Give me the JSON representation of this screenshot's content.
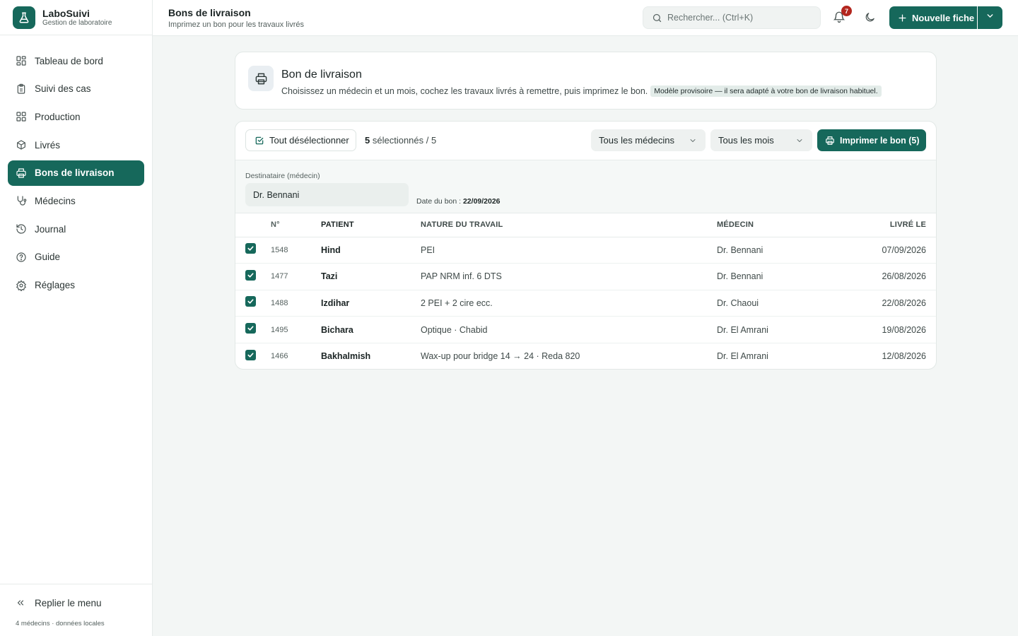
{
  "brand": {
    "title": "LaboSuivi",
    "subtitle": "Gestion de laboratoire"
  },
  "nav": {
    "items": [
      {
        "label": "Tableau de bord",
        "icon": "grid-icon"
      },
      {
        "label": "Suivi des cas",
        "icon": "clipboard-icon"
      },
      {
        "label": "Production",
        "icon": "grid-icon"
      },
      {
        "label": "Livrés",
        "icon": "package-icon"
      },
      {
        "label": "Bons de livraison",
        "icon": "printer-icon",
        "active": true
      },
      {
        "label": "Médecins",
        "icon": "stethoscope-icon"
      },
      {
        "label": "Journal",
        "icon": "history-icon"
      },
      {
        "label": "Guide",
        "icon": "help-circle-icon"
      },
      {
        "label": "Réglages",
        "icon": "gear-icon"
      }
    ],
    "collapse_label": "Replier le menu",
    "footnote": "4 médecins · données locales"
  },
  "header": {
    "title": "Bons de livraison",
    "subtitle": "Imprimez un bon pour les travaux livrés",
    "search_placeholder": "Rechercher... (Ctrl+K)",
    "notifications_count": "7",
    "new_button_label": "Nouvelle fiche"
  },
  "intro": {
    "title": "Bon de livraison",
    "description": "Choisissez un médecin et un mois, cochez les travaux livrés à remettre, puis imprimez le bon.",
    "note": "Modèle provisoire — il sera adapté à votre bon de livraison habituel."
  },
  "toolbar": {
    "deselect_label": "Tout désélectionner",
    "selected_count": "5",
    "selected_suffix": "sélectionnés / 5",
    "doctor_filter": "Tous les médecins",
    "month_filter": "Tous les mois",
    "print_label": "Imprimer le bon (5)"
  },
  "recipient": {
    "label": "Destinataire (médecin)",
    "value": "Dr. Bennani",
    "date_label": "Date du bon :",
    "date_value": "22/09/2026"
  },
  "table": {
    "headers": {
      "no": "N°",
      "patient": "PATIENT",
      "nature": "NATURE DU TRAVAIL",
      "doctor": "MÉDECIN",
      "delivered": "LIVRÉ LE"
    },
    "rows": [
      {
        "no": "1548",
        "patient": "Hind",
        "nature": "PEI",
        "doctor": "Dr. Bennani",
        "delivered": "07/09/2026",
        "checked": true
      },
      {
        "no": "1477",
        "patient": "Tazi",
        "nature": "PAP NRM inf. 6 DTS",
        "doctor": "Dr. Bennani",
        "delivered": "26/08/2026",
        "checked": true
      },
      {
        "no": "1488",
        "patient": "Izdihar",
        "nature": "2 PEI + 2 cire ecc.",
        "doctor": "Dr. Chaoui",
        "delivered": "22/08/2026",
        "checked": true
      },
      {
        "no": "1495",
        "patient": "Bichara",
        "nature": "Optique · Chabid",
        "doctor": "Dr. El Amrani",
        "delivered": "19/08/2026",
        "checked": true
      },
      {
        "no": "1466",
        "patient": "Bakhalmish",
        "nature": "Wax-up pour bridge 14 → 24 · Reda 820",
        "doctor": "Dr. El Amrani",
        "delivered": "12/08/2026",
        "checked": true
      }
    ]
  },
  "colors": {
    "accent": "#16685b",
    "badge": "#b3261e",
    "background": "#f3f6f5"
  }
}
